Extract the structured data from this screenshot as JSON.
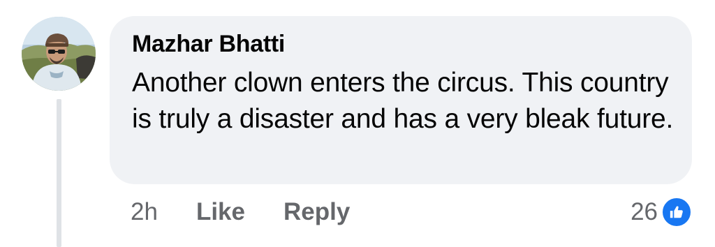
{
  "comment": {
    "author": "Mazhar Bhatti",
    "text": "Another clown enters the circus. This country is truly a disaster and has a very bleak future.",
    "timestamp": "2h",
    "like_label": "Like",
    "reply_label": "Reply",
    "reaction_count": "26",
    "reaction_icon": "thumbs-up-icon"
  },
  "colors": {
    "bubble_background": "#f0f2f5",
    "meta_text": "#65676b",
    "like_blue": "#1877f2"
  }
}
